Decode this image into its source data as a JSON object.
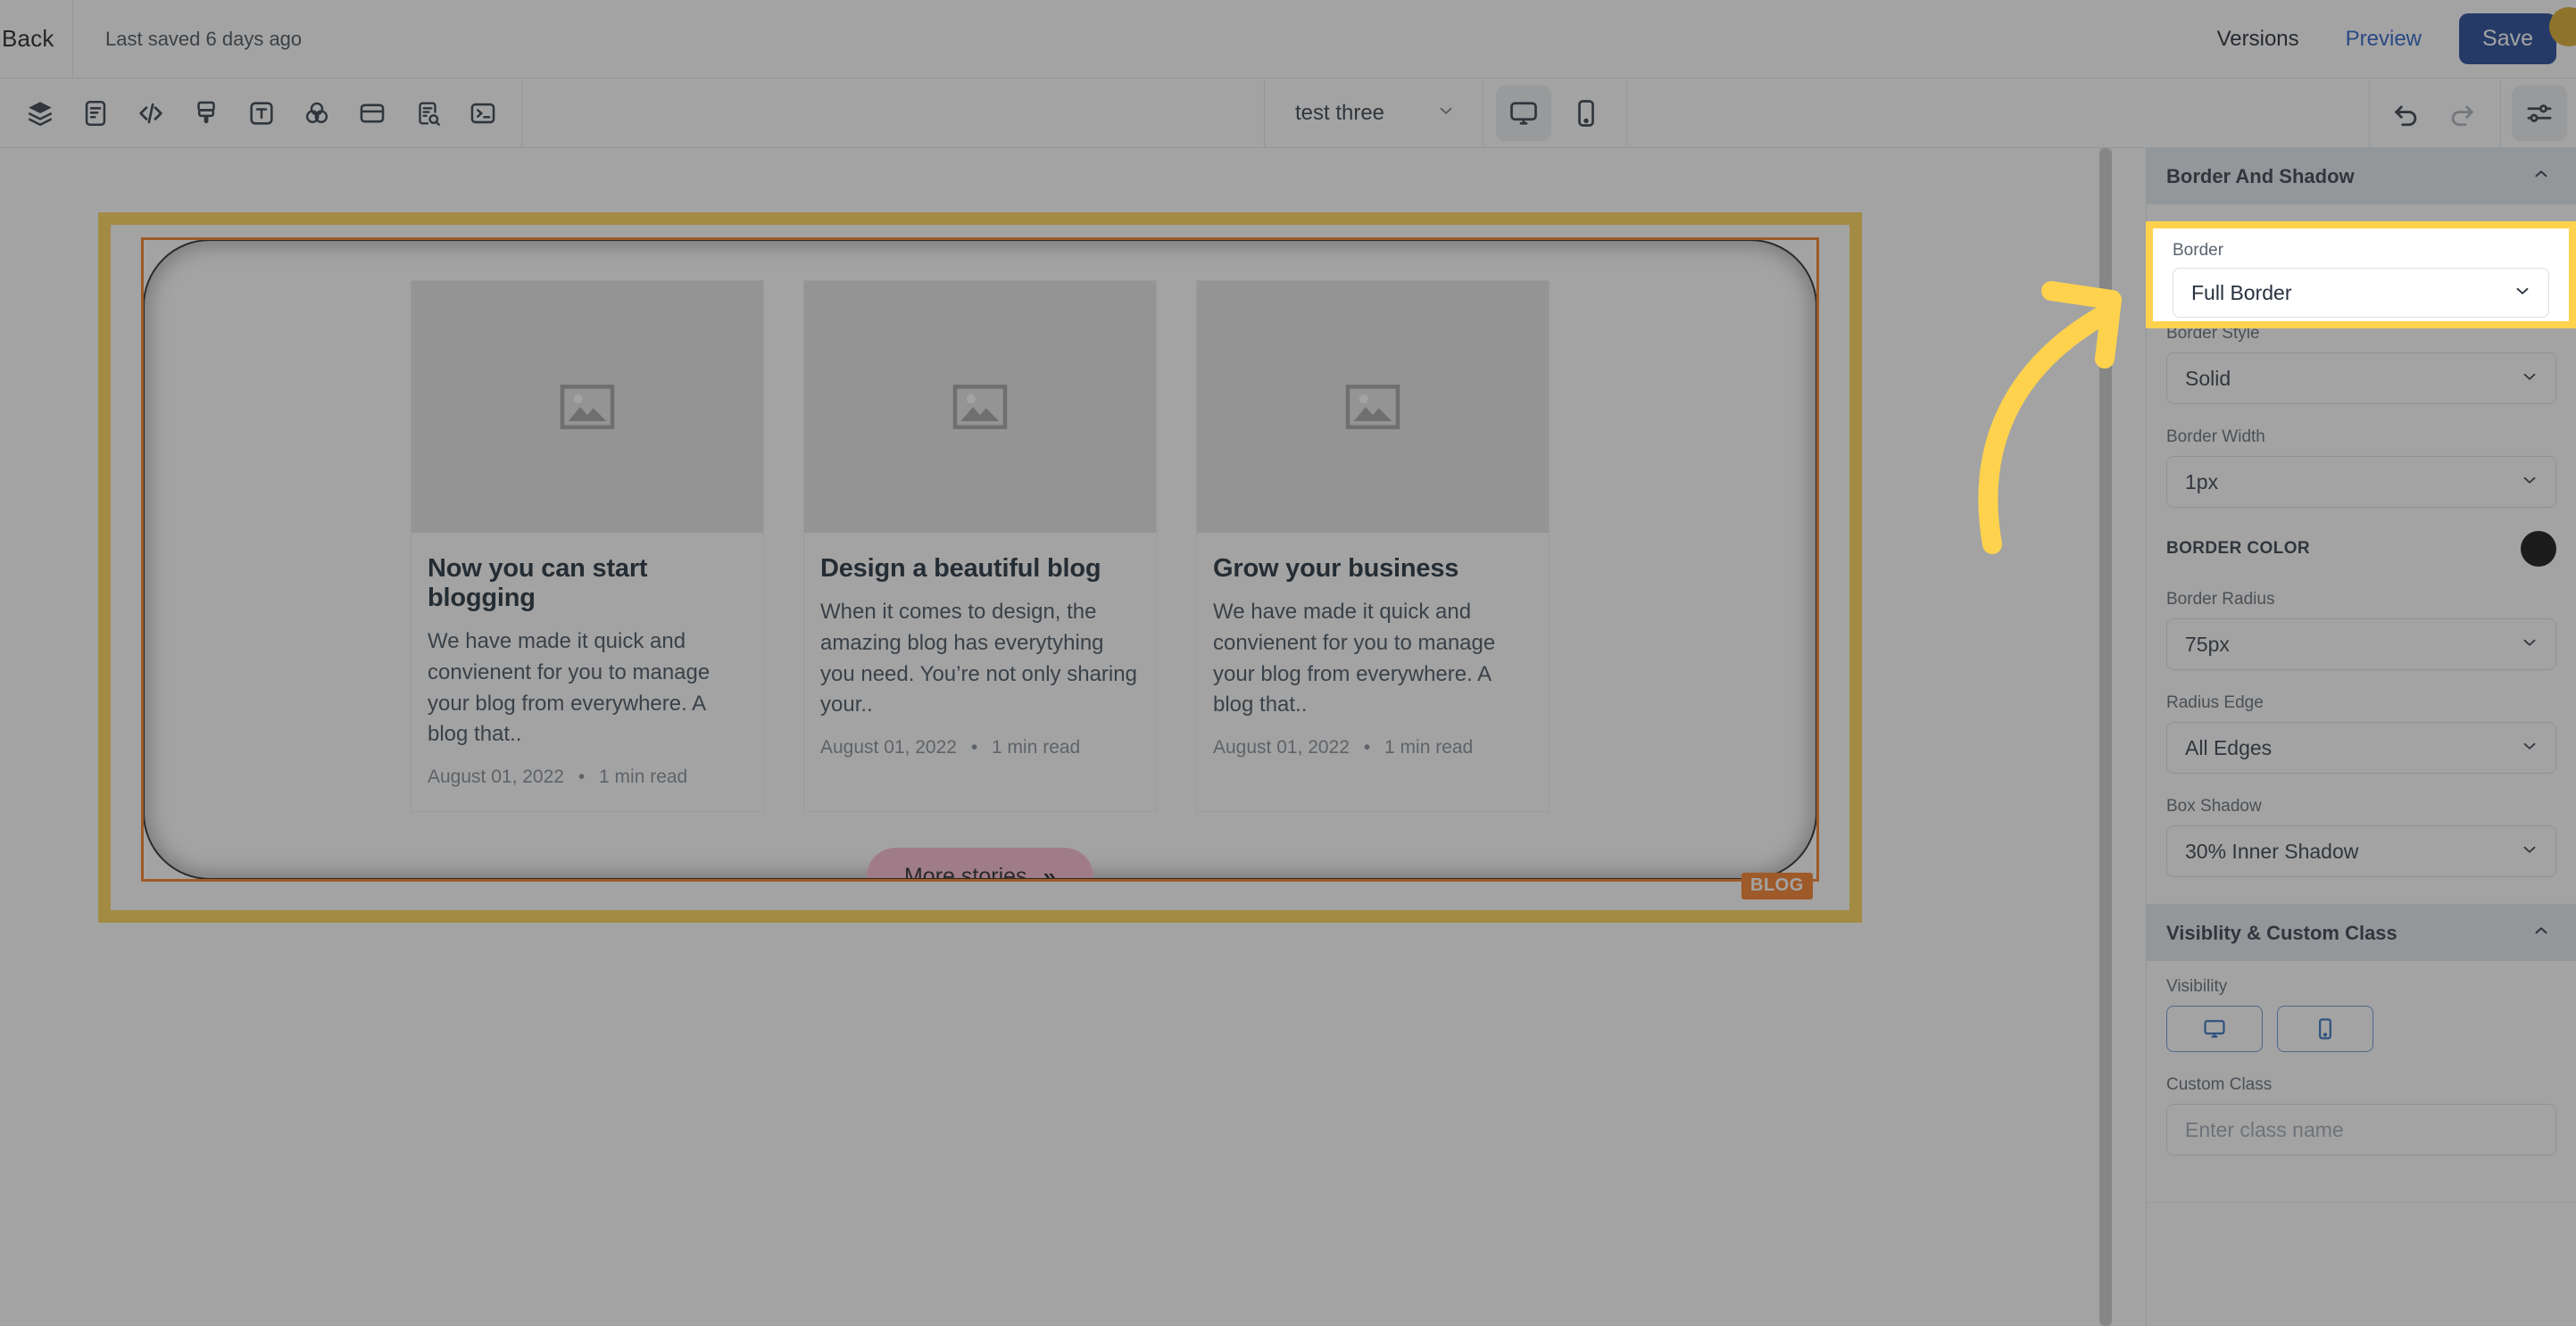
{
  "topbar": {
    "back_label": "Back",
    "saved_text": "Last saved 6 days ago",
    "versions_label": "Versions",
    "preview_label": "Preview",
    "save_label": "Save"
  },
  "toolbar": {
    "left_icons": [
      {
        "name": "layers-icon",
        "label": "Layers"
      },
      {
        "name": "pages-icon",
        "label": "Pages"
      },
      {
        "name": "code-icon",
        "label": "Code"
      },
      {
        "name": "brush-icon",
        "label": "Theme"
      },
      {
        "name": "text-icon",
        "label": "Typography"
      },
      {
        "name": "color-icon",
        "label": "Colors"
      },
      {
        "name": "card-icon",
        "label": "Layout"
      },
      {
        "name": "seo-icon",
        "label": "SEO"
      },
      {
        "name": "console-icon",
        "label": "Console"
      }
    ],
    "page_name": "test three",
    "device_desktop": "desktop-icon",
    "device_mobile": "mobile-icon",
    "undo": "undo-icon",
    "redo": "redo-icon",
    "settings": "settings-sliders-icon"
  },
  "canvas": {
    "selection_badge": "BLOG",
    "cards": [
      {
        "title": "Now you can start blogging",
        "excerpt": "We have made it quick and convienent for you to manage your blog from everywhere. A blog that..",
        "date": "August 01, 2022",
        "read_time": "1 min read"
      },
      {
        "title": "Design a beautiful blog",
        "excerpt": "When it comes to design, the amazing blog has everytyhing you need. You’re not only sharing your..",
        "date": "August 01, 2022",
        "read_time": "1 min read"
      },
      {
        "title": "Grow your business",
        "excerpt": "We have made it quick and convienent for you to manage your blog from everywhere. A blog that..",
        "date": "August 01, 2022",
        "read_time": "1 min read"
      }
    ],
    "more_button": "More stories",
    "more_chevron": "»"
  },
  "panel": {
    "border_shadow": {
      "header": "Border And Shadow",
      "border_label": "Border",
      "border_value": "Full Border",
      "border_style_label": "Border Style",
      "border_style_value": "Solid",
      "border_width_label": "Border Width",
      "border_width_value": "1px",
      "border_color_label": "BORDER COLOR",
      "border_color_value": "#000000",
      "border_radius_label": "Border Radius",
      "border_radius_value": "75px",
      "radius_edge_label": "Radius Edge",
      "radius_edge_value": "All Edges",
      "box_shadow_label": "Box Shadow",
      "box_shadow_value": "30% Inner Shadow"
    },
    "visibility": {
      "header": "Visiblity & Custom Class",
      "visibility_label": "Visibility",
      "custom_class_label": "Custom Class",
      "custom_class_placeholder": "Enter class name"
    }
  },
  "annotation": {
    "highlight_color": "#ffd24d",
    "arrow_color": "#ffd24d"
  }
}
